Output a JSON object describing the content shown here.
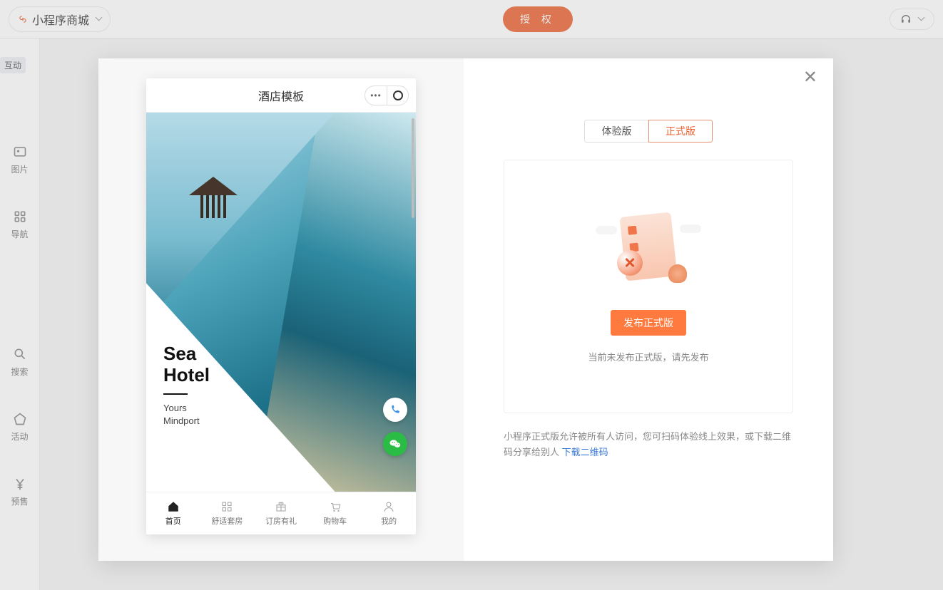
{
  "topbar": {
    "product_label": "小程序商城",
    "auth_button": "授 权"
  },
  "sidebar": {
    "chip": "互动",
    "items": [
      {
        "label": "图片"
      },
      {
        "label": "导航"
      },
      {
        "label": "搜索"
      },
      {
        "label": "活动"
      },
      {
        "label": "预售"
      }
    ]
  },
  "preview": {
    "title": "酒店模板",
    "hotel_name_line1": "Sea",
    "hotel_name_line2": "Hotel",
    "tagline_line1": "Yours",
    "tagline_line2": "Mindport",
    "tabbar": [
      {
        "label": "首页"
      },
      {
        "label": "舒适套房"
      },
      {
        "label": "订房有礼"
      },
      {
        "label": "购物车"
      },
      {
        "label": "我的"
      }
    ]
  },
  "right": {
    "tab_trial": "体验版",
    "tab_release": "正式版",
    "publish_button": "发布正式版",
    "publish_hint": "当前未发布正式版，请先发布",
    "desc_prefix": "小程序正式版允许被所有人访问，您可扫码体验线上效果，或下载二维码分享给别人 ",
    "download_qr": "下载二维码"
  }
}
